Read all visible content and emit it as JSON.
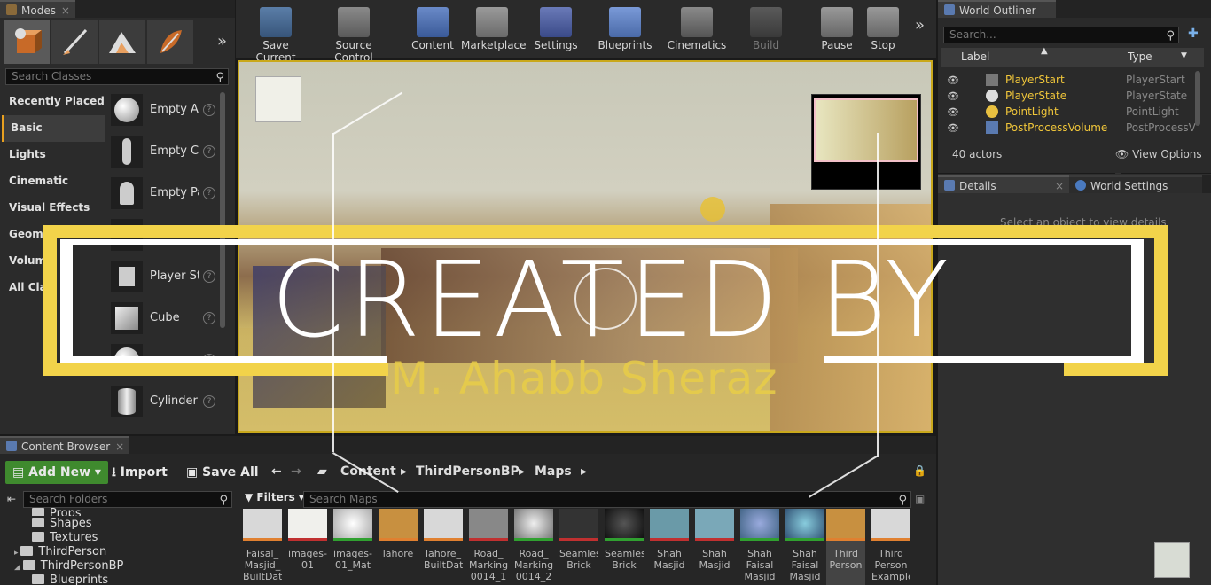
{
  "modes": {
    "tab": "Modes",
    "search_placeholder": "Search Classes",
    "categories": [
      "Recently Placed",
      "Basic",
      "Lights",
      "Cinematic",
      "Visual Effects",
      "Geometry",
      "Volumes",
      "All Classes"
    ],
    "categories_visible": [
      "Recently Placed",
      "Basic",
      "Lights",
      "Cinematic",
      "Visual Effects",
      "Geome",
      "Volum",
      "All Clas"
    ],
    "items": [
      "Empty Ac",
      "Empty Cl",
      "Empty Pa",
      "",
      "Player St",
      "Cube",
      "",
      "Cylinder"
    ]
  },
  "toolbar": {
    "buttons": [
      "Save Current",
      "Source Control",
      "Content",
      "Marketplace",
      "Settings",
      "Blueprints",
      "Cinematics",
      "Build",
      "Pause",
      "Stop"
    ]
  },
  "outliner": {
    "tab": "World Outliner",
    "search_placeholder": "Search...",
    "col_label": "Label",
    "col_type": "Type",
    "rows": [
      {
        "label": "PlayerStart",
        "type": "PlayerStart"
      },
      {
        "label": "PlayerState",
        "type": "PlayerState"
      },
      {
        "label": "PointLight",
        "type": "PointLight"
      },
      {
        "label": "PostProcessVolume",
        "type": "PostProcessV"
      }
    ],
    "actor_count": "40 actors",
    "view_options": "View Options"
  },
  "details": {
    "tab_details": "Details",
    "tab_world": "World Settings",
    "message": "Select an object to view details"
  },
  "content_browser": {
    "tab": "Content Browser",
    "add_new": "Add New",
    "import": "Import",
    "save_all": "Save All",
    "breadcrumbs": [
      "Content",
      "ThirdPersonBP",
      "Maps"
    ],
    "search_folders": "Search Folders",
    "filters": "Filters",
    "search_maps": "Search Maps",
    "folders": [
      "Props",
      "Shapes",
      "Textures",
      "ThirdPerson",
      "ThirdPersonBP",
      "Blueprints"
    ],
    "assets": [
      "Faisal_ Masjid_ BuiltData",
      "images- 01",
      "images- 01_Mat",
      "lahore",
      "lahore_ BuiltData",
      "Road_ Marking_ 0014_1",
      "Road_ Marking_ 0014_2",
      "Seamless Brick",
      "Seamless Brick",
      "Shah Masjid",
      "Shah Masjid",
      "Shah Faisal Masjid",
      "Shah Faisal Masjid",
      "Third Person",
      "Third Person Example"
    ]
  },
  "overlay": {
    "title": "CREATED BY",
    "author": "M. Ahabb Sheraz"
  },
  "colors": {
    "accent_yellow": "#f2d34a",
    "label_yellow": "#f0c63a",
    "add_new_green": "#3f8a2e"
  }
}
